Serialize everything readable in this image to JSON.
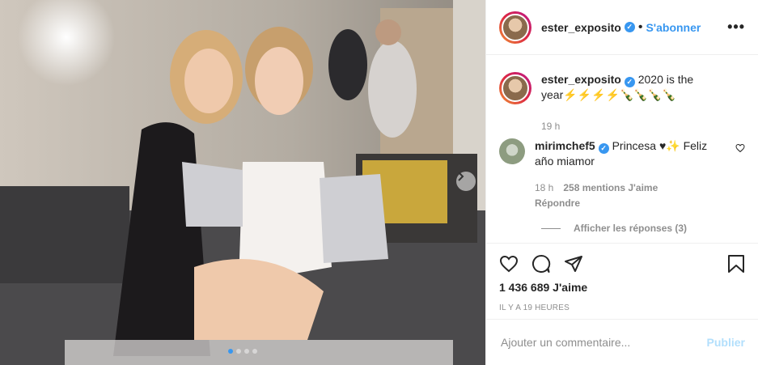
{
  "photo": {
    "alt_icon": "photo",
    "next_icon": "chevron-right-icon",
    "carousel_total": 4,
    "carousel_active": 1
  },
  "header": {
    "username": "ester_exposito",
    "separator": "•",
    "follow_label": "S'abonner",
    "more_icon": "more-horizontal-icon",
    "more_label": "•••"
  },
  "caption": {
    "username": "ester_exposito",
    "text": "2020 is the year⚡⚡⚡⚡🍾🍾🍾🍾",
    "time": "19 h"
  },
  "comment": {
    "username": "mirimchef5",
    "text": "Princesa ♥✨ Feliz año miamor",
    "time": "18 h",
    "likes": "258 mentions J'aime",
    "reply_label": "Répondre",
    "view_replies": "Afficher les réponses (3)"
  },
  "actions": {
    "likes": "1 436 689 J'aime",
    "time": "IL Y A 19 HEURES"
  },
  "add_comment": {
    "placeholder": "Ajouter un commentaire...",
    "publish_label": "Publier"
  },
  "colors": {
    "accent": "#3897f0",
    "publish_disabled": "#b2dffc",
    "muted": "#8e8e8e"
  }
}
